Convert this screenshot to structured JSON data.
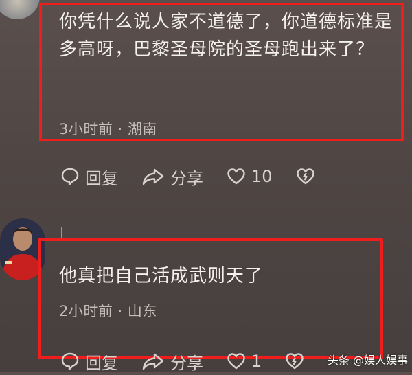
{
  "comments": [
    {
      "text": "你凭什么说人家不道德了，你道德标准是多高呀，巴黎圣母院的圣母跑出来了？",
      "meta": "3小时前 · 湖南",
      "reply_label": "回复",
      "share_label": "分享",
      "like_count": "10"
    },
    {
      "text": "他真把自己活成武则天了",
      "meta": "2小时前 · 山东",
      "reply_label": "回复",
      "share_label": "分享",
      "like_count": "1"
    }
  ],
  "watermark": "头条 @娱人娱事",
  "colors": {
    "highlight_border": "#f01d1d",
    "background": "#4f4644"
  }
}
